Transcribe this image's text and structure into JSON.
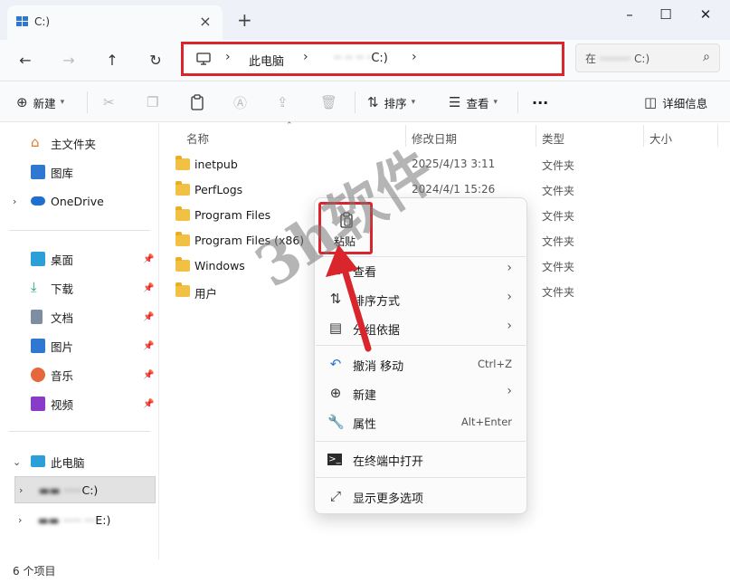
{
  "window": {
    "tab_title": "C:)",
    "tab_close": "×",
    "tab_add": "+",
    "controls": [
      "–",
      "☐",
      "✕"
    ]
  },
  "nav": {
    "back": "←",
    "forward": "→",
    "up": "↑",
    "refresh": "↻",
    "breadcrumb": [
      "此电脑",
      "C:)"
    ],
    "breadcrumb_sep": "›",
    "search_placeholder": "在",
    "search_suffix": "C:)"
  },
  "commands": {
    "new": "新建",
    "sort": "排序",
    "view": "查看",
    "more": "···",
    "details": "详细信息"
  },
  "sidebar": {
    "top": [
      {
        "label": "主文件夹",
        "icon": "home-icon"
      },
      {
        "label": "图库",
        "icon": "gallery-icon"
      },
      {
        "label": "OneDrive",
        "icon": "cloud-icon"
      }
    ],
    "pinned": [
      {
        "label": "桌面",
        "icon": "desktop-icon"
      },
      {
        "label": "下载",
        "icon": "download-icon"
      },
      {
        "label": "文档",
        "icon": "document-icon"
      },
      {
        "label": "图片",
        "icon": "picture-icon"
      },
      {
        "label": "音乐",
        "icon": "music-icon"
      },
      {
        "label": "视频",
        "icon": "video-icon"
      }
    ],
    "this_pc": "此电脑",
    "drives": [
      "C:)",
      "E:)"
    ]
  },
  "columns": {
    "name": "名称",
    "modified": "修改日期",
    "type": "类型",
    "size": "大小"
  },
  "files": [
    {
      "name": "inetpub",
      "date": "2025/4/13 3:11",
      "type": "文件夹"
    },
    {
      "name": "PerfLogs",
      "date": "2024/4/1 15:26",
      "type": "文件夹"
    },
    {
      "name": "Program Files",
      "date": "",
      "type": "文件夹"
    },
    {
      "name": "Program Files (x86)",
      "date": "",
      "type": "文件夹"
    },
    {
      "name": "Windows",
      "date": "",
      "type": "文件夹"
    },
    {
      "name": "用户",
      "date": "",
      "type": "文件夹"
    }
  ],
  "status": "6 个项目",
  "context_menu": {
    "paste": "粘贴",
    "items": [
      {
        "label": "查看",
        "icon": "grid-icon",
        "has_sub": true
      },
      {
        "label": "排序方式",
        "icon": "sort-icon",
        "has_sub": true
      },
      {
        "label": "分组依据",
        "icon": "group-icon",
        "has_sub": true
      },
      {
        "label": "撤消 移动",
        "icon": "undo-icon",
        "shortcut": "Ctrl+Z"
      },
      {
        "label": "新建",
        "icon": "new-icon",
        "has_sub": true
      },
      {
        "label": "属性",
        "icon": "wrench-icon",
        "shortcut": "Alt+Enter"
      },
      {
        "label": "在终端中打开",
        "icon": "terminal-icon"
      },
      {
        "label": "显示更多选项",
        "icon": "expand-icon"
      }
    ],
    "submenu_arrow": "›"
  },
  "watermark": "3h软件",
  "colors": {
    "highlight_red": "#d8262c",
    "folder_yellow": "#f2c143",
    "chrome_bg": "#eef1f7"
  }
}
